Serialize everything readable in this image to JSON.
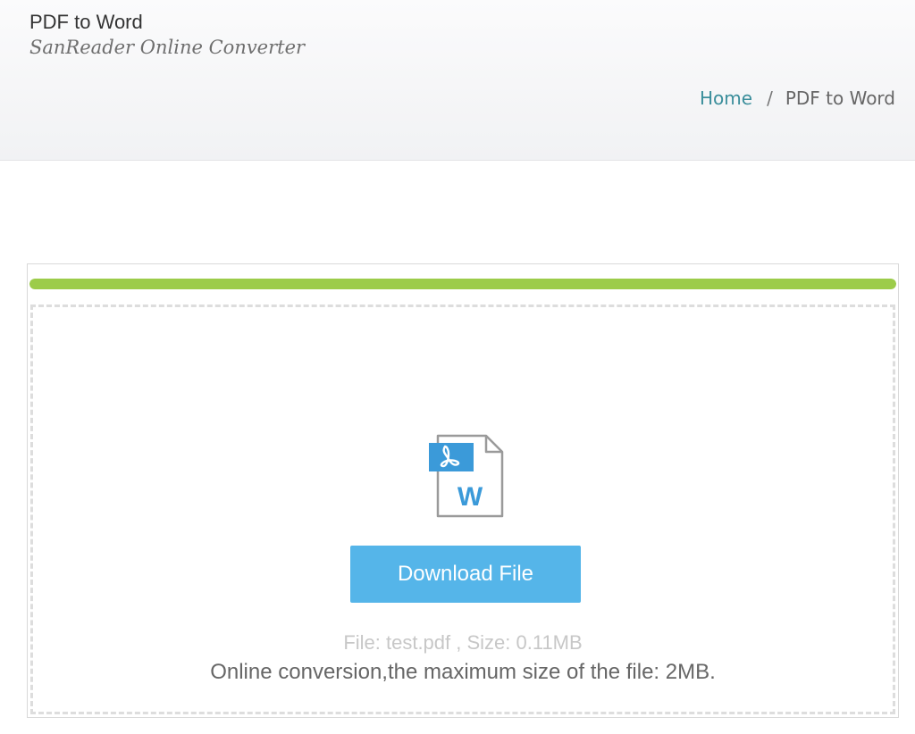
{
  "header": {
    "title": "PDF to Word",
    "subtitle": "SanReader Online Converter"
  },
  "breadcrumb": {
    "home": "Home",
    "separator": "/",
    "current": "PDF to Word"
  },
  "converter": {
    "progress_percent": 100,
    "progress_color": "#9ccc4a",
    "file_icon": "pdf-to-word-file-icon",
    "file_icon_letter": "W",
    "download_label": "Download File",
    "file_info": "File: test.pdf , Size: 0.11MB",
    "size_note": "Online conversion,the maximum size of the file: 2MB."
  },
  "colors": {
    "accent": "#55b5e9",
    "link": "#3a8e9b"
  }
}
